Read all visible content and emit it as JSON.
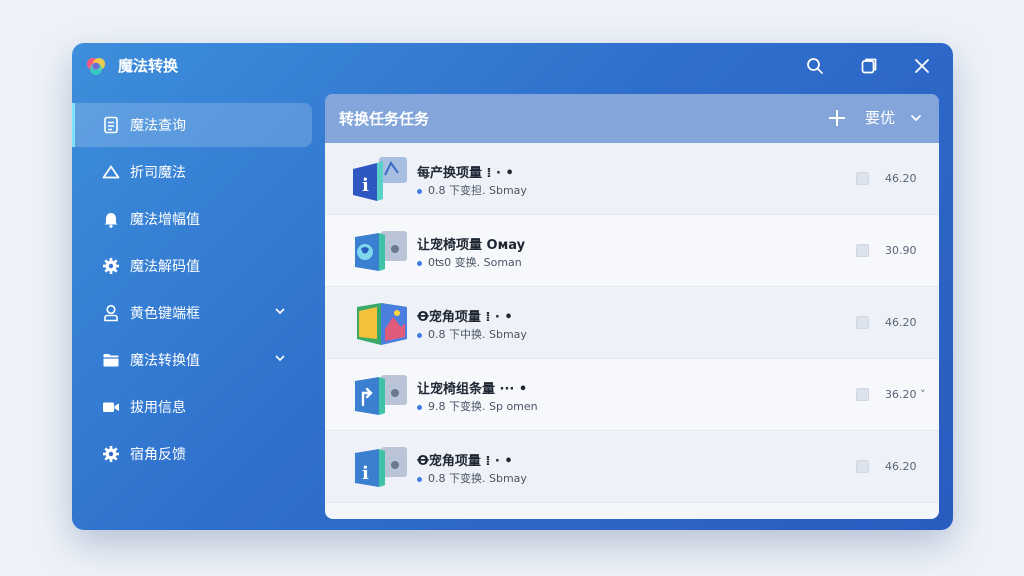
{
  "window": {
    "title": "魔法转换",
    "controls": [
      "search-icon",
      "restore-icon",
      "close-icon"
    ]
  },
  "sidebar": {
    "items": [
      {
        "label": "魔法查询",
        "icon": "document-icon",
        "active": true,
        "has_chevron": false
      },
      {
        "label": "折司魔法",
        "icon": "triangle-icon",
        "active": false,
        "has_chevron": false
      },
      {
        "label": "魔法增幅值",
        "icon": "bell-icon",
        "active": false,
        "has_chevron": false
      },
      {
        "label": "魔法解码值",
        "icon": "gear-icon",
        "active": false,
        "has_chevron": false
      },
      {
        "label": "黄色键端框",
        "icon": "user-icon",
        "active": false,
        "has_chevron": true
      },
      {
        "label": "魔法转换值",
        "icon": "folder-icon",
        "active": false,
        "has_chevron": true
      },
      {
        "label": "拔用信息",
        "icon": "camera-icon",
        "active": false,
        "has_chevron": false
      },
      {
        "label": "宿角反馈",
        "icon": "gear-icon",
        "active": false,
        "has_chevron": false
      }
    ]
  },
  "panel": {
    "title": "转换任务任务",
    "sort_label": "要优",
    "tasks": [
      {
        "title": "每产换项量 ⁞ ·  •",
        "sub": "0.8 下变担. Sbmay",
        "value": "46.20",
        "thumb": "i-doc"
      },
      {
        "title": "让宠椅项量 Oмay",
        "sub": "0ʦ0 变换. Soman",
        "value": "30.90",
        "thumb": "globe-doc"
      },
      {
        "title": "Ꝋ宠角项量 ⁞ ·  •",
        "sub": "0.8 下中换. Sbmay",
        "value": "46.20",
        "thumb": "image-doc"
      },
      {
        "title": "让宠椅组条量 ··· •",
        "sub": "9.8 下变换. Sp omen",
        "value": "36.20 ˅",
        "thumb": "arrow-doc"
      },
      {
        "title": "Ꝋ宠角项量 ⁞ ·  •",
        "sub": "0.8 下变换. Sbmay",
        "value": "46.20",
        "thumb": "i-doc"
      }
    ]
  },
  "colors": {
    "window_top": "#3d8fdc",
    "window_bottom": "#2a5cc0",
    "panel_header": "#6f96d4",
    "active_bar": "#7fe3ff",
    "dot": "#3d7ddc"
  }
}
